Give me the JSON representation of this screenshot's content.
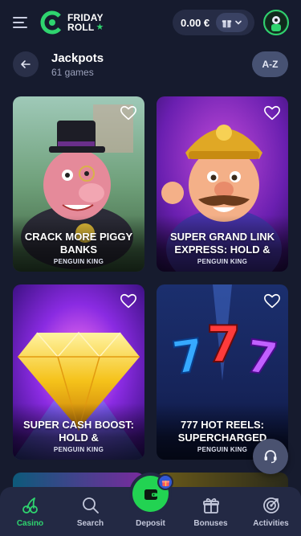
{
  "header": {
    "brand_line1": "FRIDAY",
    "brand_line2": "ROLL",
    "balance": "0.00 €"
  },
  "title_row": {
    "title": "Jackpots",
    "subtitle": "61 games",
    "sort_label": "A-Z"
  },
  "games": [
    {
      "title": "CRACK MORE PIGGY BANKS",
      "provider": "PENGUIN KING"
    },
    {
      "title": "SUPER GRAND LINK EXPRESS: HOLD &",
      "provider": "PENGUIN KING"
    },
    {
      "title": "SUPER CASH BOOST: HOLD &",
      "provider": "PENGUIN KING"
    },
    {
      "title": "777 HOT REELS: SUPERCHARGED",
      "provider": "PENGUIN KING"
    }
  ],
  "nav": {
    "items": [
      {
        "label": "Casino",
        "icon": "cherries-icon",
        "active": true
      },
      {
        "label": "Search",
        "icon": "search-icon",
        "active": false
      },
      {
        "label": "Deposit",
        "icon": "wallet-icon",
        "active": false
      },
      {
        "label": "Bonuses",
        "icon": "gift-icon",
        "active": false
      },
      {
        "label": "Activities",
        "icon": "target-icon",
        "active": false
      }
    ]
  },
  "colors": {
    "background": "#161b2e",
    "accent_green": "#2fd46f",
    "nav_background": "#232944"
  }
}
